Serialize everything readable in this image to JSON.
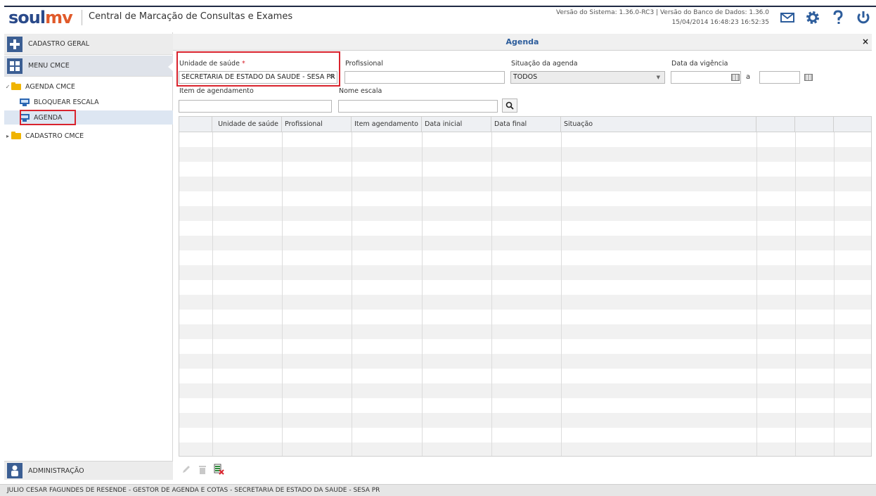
{
  "header": {
    "logo_soul": "soul",
    "logo_mv": "mv",
    "app_title": "Central de Marcação de Consultas e Exames",
    "version_line1": "Versão do Sistema: 1.36.0-RC3 | Versão do Banco de Dados: 1.36.0",
    "version_line2": "15/04/2014 16:48:23   16:52:35",
    "icons": [
      "mail-icon",
      "gear-icon",
      "help-icon",
      "power-icon"
    ]
  },
  "sidebar": {
    "cadastro_geral": "CADASTRO GERAL",
    "menu_cmce": "MENU CMCE",
    "tree": {
      "agenda_cmce": "AGENDA CMCE",
      "bloquear_escala": "BLOQUEAR ESCALA",
      "agenda": "AGENDA",
      "cadastro_cmce": "CADASTRO CMCE"
    },
    "administracao": "ADMINISTRAÇÃO"
  },
  "main": {
    "title": "Agenda",
    "close": "×",
    "filters": {
      "unidade_label": "Unidade de saúde",
      "required_mark": "*",
      "unidade_value": "SECRETARIA DE ESTADO DA SAUDE - SESA PR",
      "profissional_label": "Profissional",
      "profissional_value": "",
      "situacao_label": "Situação da agenda",
      "situacao_value": "TODOS",
      "vigencia_label": "Data da vigência",
      "vigencia_sep": "a",
      "item_label": "Item de agendamento",
      "item_value": "",
      "nome_escala_label": "Nome escala",
      "nome_escala_value": ""
    },
    "grid": {
      "columns": [
        "",
        "Unidade de saúde",
        "Profissional",
        "Item agendamento",
        "Data inicial",
        "Data final",
        "Situação",
        "",
        "",
        ""
      ],
      "rows": []
    }
  },
  "status_bar": "JULIO CESAR FAGUNDES DE RESENDE - GESTOR DE AGENDA E COTAS - SECRETARIA DE ESTADO DA SAUDE - SESA PR",
  "colors": {
    "accent": "#2d5d9c",
    "highlight": "#d9232d",
    "brand_orange": "#e05a2a"
  }
}
